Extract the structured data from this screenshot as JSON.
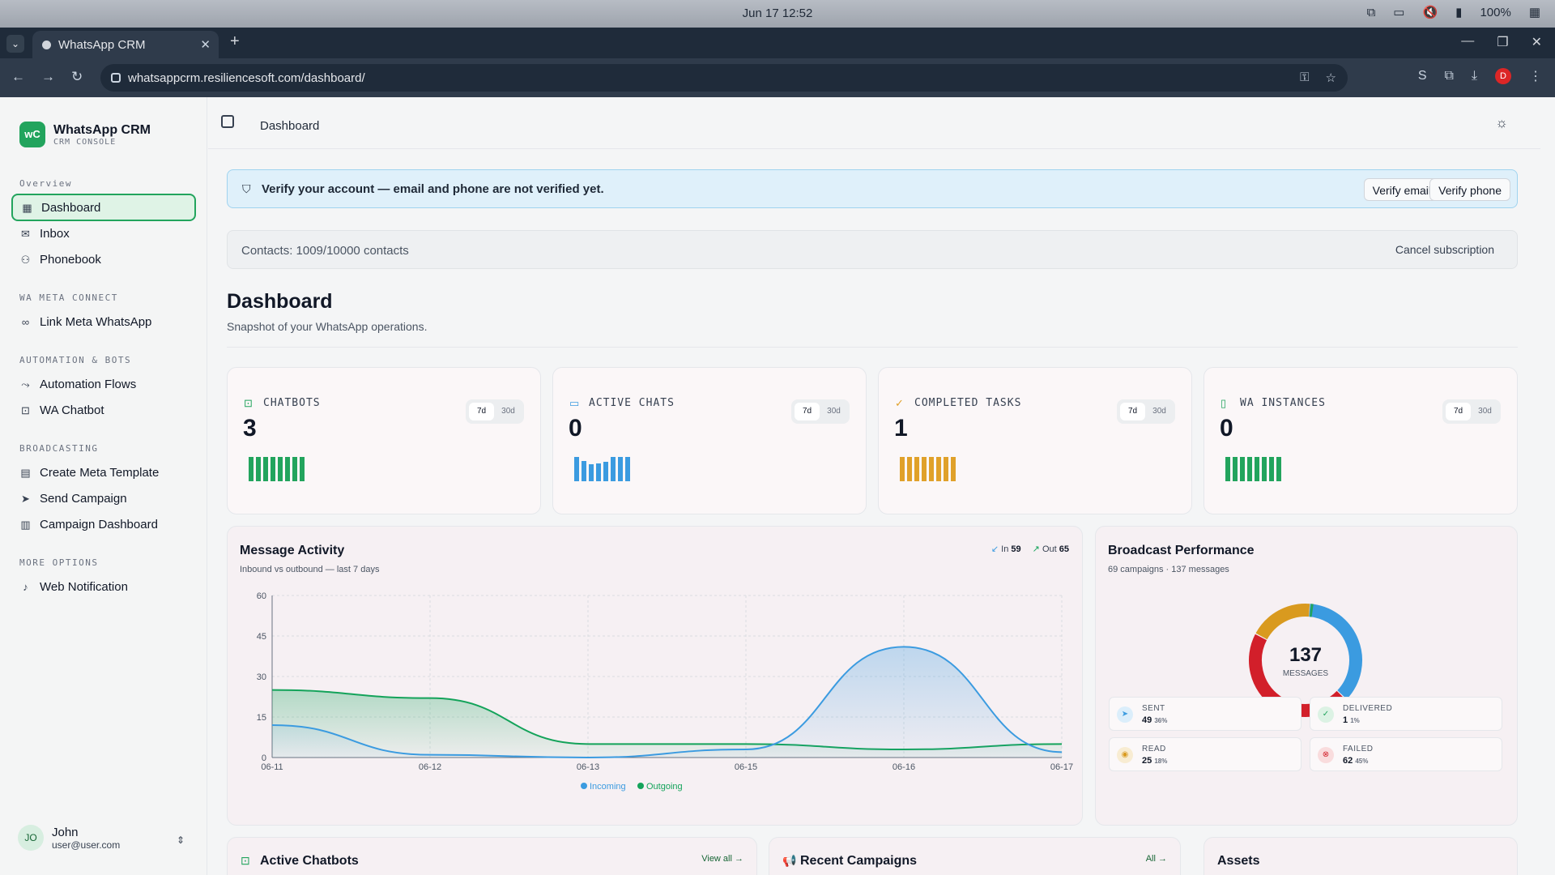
{
  "os": {
    "clock": "Jun 17  12:52",
    "battery": "100%"
  },
  "browser": {
    "tab_title": "WhatsApp CRM",
    "url": "whatsappcrm.resiliencesoft.com/dashboard/",
    "profile": "D"
  },
  "sidebar": {
    "brand": {
      "logo": "wC",
      "title": "WhatsApp CRM",
      "subtitle": "CRM CONSOLE"
    },
    "sections": [
      {
        "title": "Overview",
        "items": [
          {
            "label": "Dashboard",
            "icon": "grid-icon"
          },
          {
            "label": "Inbox",
            "icon": "inbox-icon"
          },
          {
            "label": "Phonebook",
            "icon": "users-icon"
          }
        ]
      },
      {
        "title": "WA META CONNECT",
        "items": [
          {
            "label": "Link Meta WhatsApp",
            "icon": "link-icon"
          }
        ]
      },
      {
        "title": "AUTOMATION & BOTS",
        "items": [
          {
            "label": "Automation Flows",
            "icon": "flow-icon"
          },
          {
            "label": "WA Chatbot",
            "icon": "bot-icon"
          }
        ]
      },
      {
        "title": "BROADCASTING",
        "items": [
          {
            "label": "Create Meta Template",
            "icon": "file-icon"
          },
          {
            "label": "Send Campaign",
            "icon": "send-icon"
          },
          {
            "label": "Campaign Dashboard",
            "icon": "bar-chart-icon"
          }
        ]
      },
      {
        "title": "MORE OPTIONS",
        "items": [
          {
            "label": "Web Notification",
            "icon": "bell-icon"
          }
        ]
      }
    ],
    "user": {
      "initials": "JO",
      "name": "John",
      "email": "user@user.com"
    }
  },
  "topbar": {
    "breadcrumb": "Dashboard"
  },
  "banner": {
    "text": "Verify your account — email and phone are not verified yet.",
    "verify_email": "Verify email",
    "verify_phone": "Verify phone"
  },
  "contacts": {
    "text": "Contacts: 1009/10000 contacts",
    "cancel": "Cancel subscription"
  },
  "page": {
    "title": "Dashboard",
    "subtitle": "Snapshot of your WhatsApp operations."
  },
  "stats": [
    {
      "label": "CHATBOTS",
      "value": "3",
      "r7": "7d",
      "r30": "30d",
      "color": "#22a45d",
      "spark": [
        1,
        1,
        1,
        1,
        1,
        1,
        1,
        1
      ]
    },
    {
      "label": "ACTIVE CHATS",
      "value": "0",
      "r7": "7d",
      "r30": "30d",
      "color": "#3b9be0",
      "spark": [
        1,
        0.85,
        0.7,
        0.75,
        0.8,
        1,
        1,
        1
      ]
    },
    {
      "label": "COMPLETED TASKS",
      "value": "1",
      "r7": "7d",
      "r30": "30d",
      "color": "#e0a12a",
      "spark": [
        1,
        1,
        1,
        1,
        1,
        1,
        1,
        1
      ]
    },
    {
      "label": "WA INSTANCES",
      "value": "0",
      "r7": "7d",
      "r30": "30d",
      "color": "#22a45d",
      "spark": [
        1,
        1,
        1,
        1,
        1,
        1,
        1,
        1
      ]
    }
  ],
  "message_activity": {
    "title": "Message Activity",
    "subtitle": "Inbound vs outbound — last 7 days",
    "in_label": "In",
    "in_value": "59",
    "out_label": "Out",
    "out_value": "65"
  },
  "broadcast": {
    "title": "Broadcast Performance",
    "subtitle": "69 campaigns · 137 messages",
    "center_value": "137",
    "center_label": "MESSAGES",
    "tiles": [
      {
        "label": "SENT",
        "value": "49",
        "pct": "36%",
        "color": "#3b9be0",
        "bg": "#dbeefb",
        "icon": "send-icon"
      },
      {
        "label": "DELIVERED",
        "value": "1",
        "pct": "1%",
        "color": "#22a45d",
        "bg": "#dcf2e4",
        "icon": "check-icon"
      },
      {
        "label": "READ",
        "value": "25",
        "pct": "18%",
        "color": "#d99a1f",
        "bg": "#f8ecd2",
        "icon": "eye-icon"
      },
      {
        "label": "FAILED",
        "value": "62",
        "pct": "45%",
        "color": "#d21f2a",
        "bg": "#f9dcdd",
        "icon": "x-circle-icon"
      }
    ]
  },
  "bottom": {
    "chatbots_title": "Active Chatbots",
    "chatbots_link": "View all →",
    "campaigns_title": "Recent Campaigns",
    "campaigns_link": "All →",
    "assets_title": "Assets"
  },
  "chart_data": [
    {
      "type": "area",
      "title": "Message Activity",
      "categories": [
        "06-11",
        "06-12",
        "06-13",
        "06-15",
        "06-16",
        "06-17"
      ],
      "ylim": [
        0,
        60
      ],
      "yticks": [
        0,
        15,
        30,
        45,
        60
      ],
      "grid": true,
      "legend": "bottom",
      "series": [
        {
          "name": "Incoming",
          "color": "#3b9be0",
          "values": [
            12,
            1,
            0,
            3,
            41,
            2
          ]
        },
        {
          "name": "Outgoing",
          "color": "#14a35a",
          "values": [
            25,
            22,
            5,
            5,
            3,
            5
          ]
        }
      ]
    },
    {
      "type": "pie",
      "title": "Broadcast Performance",
      "categories": [
        "Sent",
        "Delivered",
        "Read",
        "Failed"
      ],
      "values": [
        49,
        1,
        25,
        62
      ],
      "colors": [
        "#3b9be0",
        "#22a45d",
        "#d99a1f",
        "#d21f2a"
      ]
    }
  ]
}
